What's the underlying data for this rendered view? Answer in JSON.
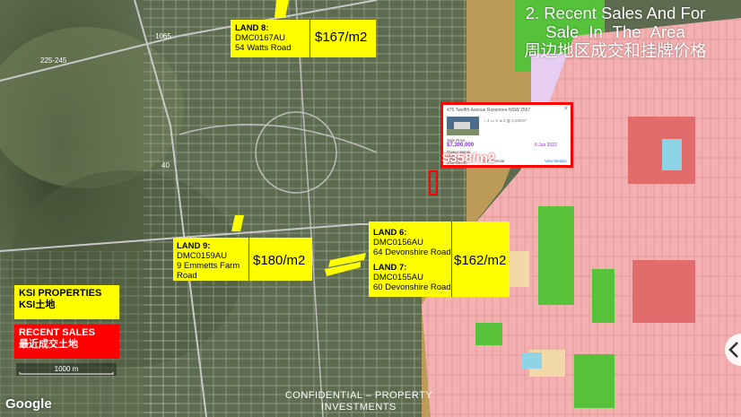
{
  "title": {
    "line1": "2. Recent Sales And For",
    "line2": "Sale In The Area",
    "line3": "周边地区成交和挂牌价格"
  },
  "land8": {
    "name": "LAND 8:",
    "code": "DMC0167AU",
    "address": "54 Watts Road",
    "price": "$167/m2"
  },
  "land9": {
    "name": "LAND 9:",
    "code": "DMC0159AU",
    "address_line1": "9 Emmetts Farm",
    "address_line2": "Road",
    "price": "$180/m2"
  },
  "land6": {
    "name": "LAND 6:",
    "code": "DMC0156AU",
    "address": "64 Devonshire Road"
  },
  "land7": {
    "name": "LAND 7:",
    "code": "DMC0155AU",
    "address": "60 Devonshire Road"
  },
  "land67_price": "$162/m2",
  "recent_sale": {
    "address": "475 Twelfth Avenue Rossmore NSW 2557",
    "price_label": "Sale Price",
    "price": "$7,300,000",
    "date": "6 Jun 2022",
    "owner_label": "Owner Name",
    "owner": "(600)",
    "lot_label": "Lot/Plan",
    "lot": "1/DP28740",
    "type": "Commercial",
    "details_link": "View Details",
    "price_per_m2": "$358/m2"
  },
  "legend": {
    "ksi_en": "KSI PROPERTIES",
    "ksi_cn": "KSI土地",
    "recent_en": "RECENT SALES",
    "recent_cn": "最近成交土地"
  },
  "map": {
    "road_label_1": "1065",
    "road_label_2": "225-245",
    "road_label_3": "40",
    "scale_label": "1000 m",
    "attribution": "Google",
    "footer_line1": "CONFIDENTIAL – PROPERTY",
    "footer_line2": "INVESTMENTS"
  },
  "colors": {
    "ksi_yellow": "#ffff00",
    "recent_red": "#ff0000",
    "zone_pink": "#f4b0b0",
    "zone_green": "#55c23a",
    "zone_tan": "#c6a15b"
  },
  "icons": {
    "popup_close": "close-icon",
    "next_arrow": "chevron-right-icon"
  }
}
